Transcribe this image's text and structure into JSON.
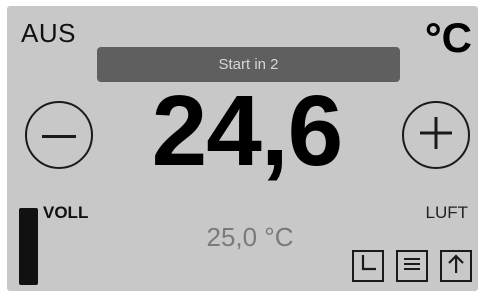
{
  "header": {
    "mode": "AUS",
    "unit": "°C"
  },
  "status": {
    "text": "Start in 2"
  },
  "setpoint": {
    "value": "24,6",
    "decrease_icon": "minus-icon",
    "increase_icon": "plus-icon"
  },
  "readings": {
    "actual_temperature": "25,0 °C",
    "fill_label": "VOLL",
    "fan_label": "LUFT"
  },
  "controls": {
    "timer_icon": "clock-icon",
    "menu_icon": "menu-icon",
    "up_icon": "arrow-up-icon"
  },
  "colors": {
    "panel": "#c8c8c8",
    "status_bar": "#5f5f5f",
    "actual_temp_text": "#7a7a7a"
  }
}
